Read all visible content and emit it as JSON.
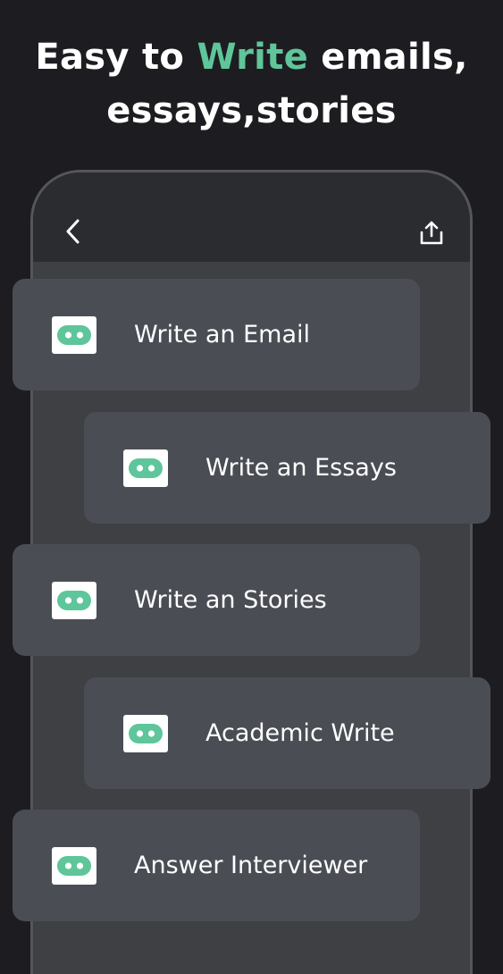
{
  "headline": {
    "part1": "Easy to ",
    "accent": "Write",
    "part2": " emails,",
    "line2": "essays,stories"
  },
  "colors": {
    "background": "#1d1d21",
    "accent": "#5fc59a",
    "card": "#4a4d54",
    "phone_screen": "#3f4044",
    "phone_header": "#2b2c2f"
  },
  "toolbar": {
    "back_icon": "chevron-left-icon",
    "share_icon": "share-upload-icon"
  },
  "cards": [
    {
      "label": "Write an Email",
      "icon": "robot-icon"
    },
    {
      "label": "Write an Essays",
      "icon": "robot-icon"
    },
    {
      "label": "Write an Stories",
      "icon": "robot-icon"
    },
    {
      "label": "Academic Write",
      "icon": "robot-icon"
    },
    {
      "label": "Answer Interviewer",
      "icon": "robot-icon"
    }
  ]
}
